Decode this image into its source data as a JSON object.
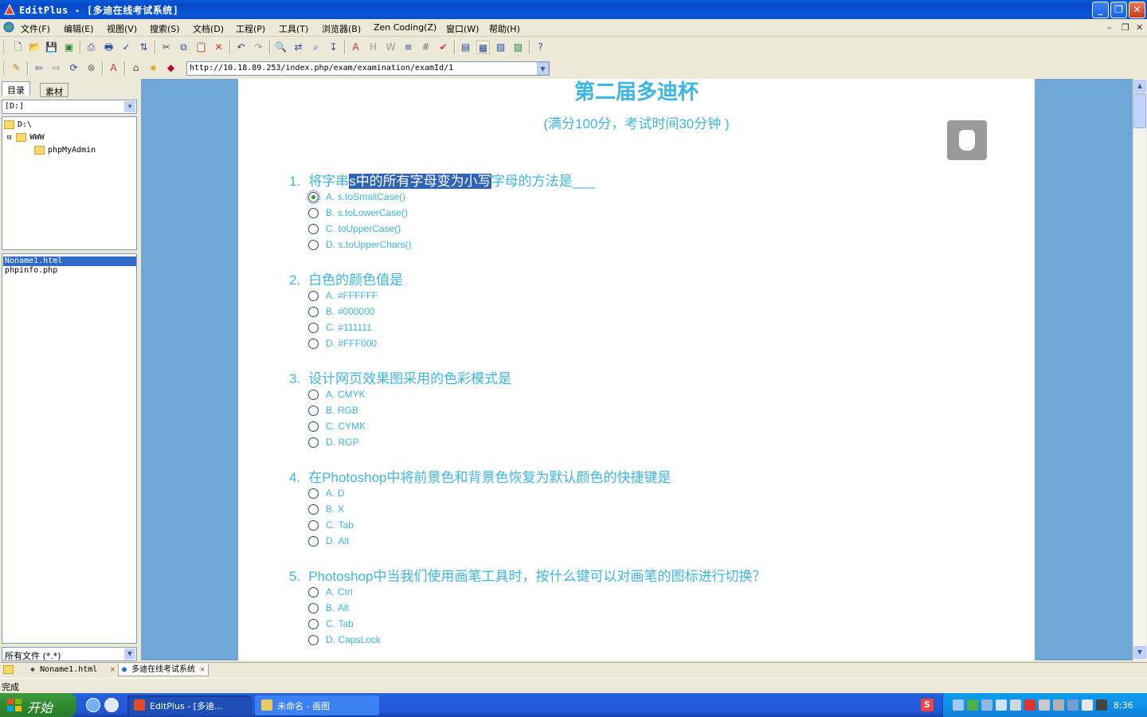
{
  "window": {
    "title": "EditPlus - [多迪在线考试系统]",
    "controls": {
      "minimize": "_",
      "restore": "❐",
      "close": "✕"
    }
  },
  "menu": {
    "items": [
      "文件(F)",
      "编辑(E)",
      "视图(V)",
      "搜索(S)",
      "文档(D)",
      "工程(P)",
      "工具(T)",
      "浏览器(B)",
      "Zen Coding(Z)",
      "窗口(W)",
      "帮助(H)"
    ],
    "mdi_controls": [
      "–",
      "❐",
      "✕"
    ]
  },
  "browser_toolbar": {
    "url": "http://10.18.89.253/index.php/exam/examination/examId/1"
  },
  "left_panel": {
    "tabs": [
      "目录",
      "素材"
    ],
    "drive": "[D:]",
    "tree": [
      {
        "label": "D:\\",
        "depth": 0
      },
      {
        "label": "WWW",
        "depth": 1,
        "expander": "⊟"
      },
      {
        "label": "phpMyAdmin",
        "depth": 2
      }
    ],
    "files": [
      {
        "name": "Noname1.html",
        "selected": true
      },
      {
        "name": "phpinfo.php",
        "selected": false
      }
    ],
    "filter": "所有文件 (*.*)"
  },
  "exam": {
    "title": "第二届多迪杯",
    "subtitle": "(满分100分，考试时间30分钟 )",
    "questions": [
      {
        "number": "1.",
        "text_before": "将字串",
        "text_highlight": "s中的所有字母变为小写",
        "text_after": "字母的方法是___",
        "options": [
          {
            "letter": "A.",
            "text": "s.toSmallCase()",
            "checked": true
          },
          {
            "letter": "B.",
            "text": "s.toLowerCase()",
            "checked": false
          },
          {
            "letter": "C.",
            "text": "toUpperCase()",
            "checked": false
          },
          {
            "letter": "D.",
            "text": "s.toUpperChars()",
            "checked": false
          }
        ]
      },
      {
        "number": "2.",
        "text": "白色的颜色值是",
        "options": [
          {
            "letter": "A.",
            "text": "#FFFFFF",
            "checked": false
          },
          {
            "letter": "B.",
            "text": "#000000",
            "checked": false
          },
          {
            "letter": "C.",
            "text": "#111111",
            "checked": false
          },
          {
            "letter": "D.",
            "text": "#FFF000",
            "checked": false
          }
        ]
      },
      {
        "number": "3.",
        "text": "设计网页效果图采用的色彩模式是",
        "options": [
          {
            "letter": "A.",
            "text": "CMYK",
            "checked": false
          },
          {
            "letter": "B.",
            "text": "RGB",
            "checked": false
          },
          {
            "letter": "C.",
            "text": "CYMK",
            "checked": false
          },
          {
            "letter": "D.",
            "text": "RGP",
            "checked": false
          }
        ]
      },
      {
        "number": "4.",
        "text": "在Photoshop中将前景色和背景色恢复为默认颜色的快捷键是",
        "options": [
          {
            "letter": "A.",
            "text": "D",
            "checked": false
          },
          {
            "letter": "B.",
            "text": "X",
            "checked": false
          },
          {
            "letter": "C.",
            "text": "Tab",
            "checked": false
          },
          {
            "letter": "D.",
            "text": "Alt",
            "checked": false
          }
        ]
      },
      {
        "number": "5.",
        "text": "Photoshop中当我们使用画笔工具时，按什么键可以对画笔的图标进行切换？",
        "options": [
          {
            "letter": "A.",
            "text": "Ctrl",
            "checked": false
          },
          {
            "letter": "B.",
            "text": "Alt",
            "checked": false
          },
          {
            "letter": "C.",
            "text": "Tab",
            "checked": false
          },
          {
            "letter": "D.",
            "text": "CapsLock",
            "checked": false
          }
        ]
      }
    ]
  },
  "doc_tabs": [
    {
      "label": "Noname1.html",
      "active": false
    },
    {
      "label": "多迪在线考试系统",
      "active": true
    }
  ],
  "status": {
    "text": "完成"
  },
  "taskbar": {
    "start_label": "开始",
    "tasks": [
      {
        "label": "EditPlus - [多迪...",
        "active": true
      },
      {
        "label": "未命名 - 画图",
        "active": false
      }
    ],
    "clock": "8:36",
    "ime_label": "S"
  },
  "colors": {
    "accent": "#3cb6e4",
    "selection": "#2f63b7",
    "page_bg": "#6fa8d6",
    "titlebar": "#0a55d9"
  }
}
